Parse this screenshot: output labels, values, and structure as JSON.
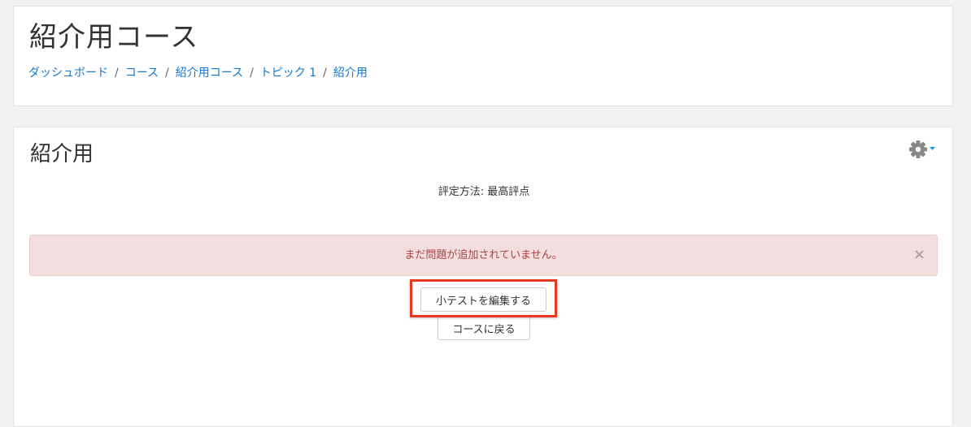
{
  "header": {
    "title": "紹介用コース",
    "breadcrumb": [
      {
        "label": "ダッシュボード"
      },
      {
        "label": "コース"
      },
      {
        "label": "紹介用コース"
      },
      {
        "label": "トピック 1"
      },
      {
        "label": "紹介用"
      }
    ],
    "separator": "/"
  },
  "main": {
    "title": "紹介用",
    "settings_icon": "gear-icon",
    "grading_method": "評定方法: 最高評点",
    "alert": {
      "message": "まだ問題が追加されていません。",
      "close_symbol": "×"
    },
    "buttons": {
      "edit_quiz": "小テストを編集する",
      "back_to_course": "コースに戻る"
    }
  },
  "colors": {
    "link": "#1177d1",
    "alert_bg": "#f2dede",
    "alert_text": "#a94442",
    "highlight": "#e8381f",
    "gear": "#888888",
    "caret": "#1a9be0"
  }
}
